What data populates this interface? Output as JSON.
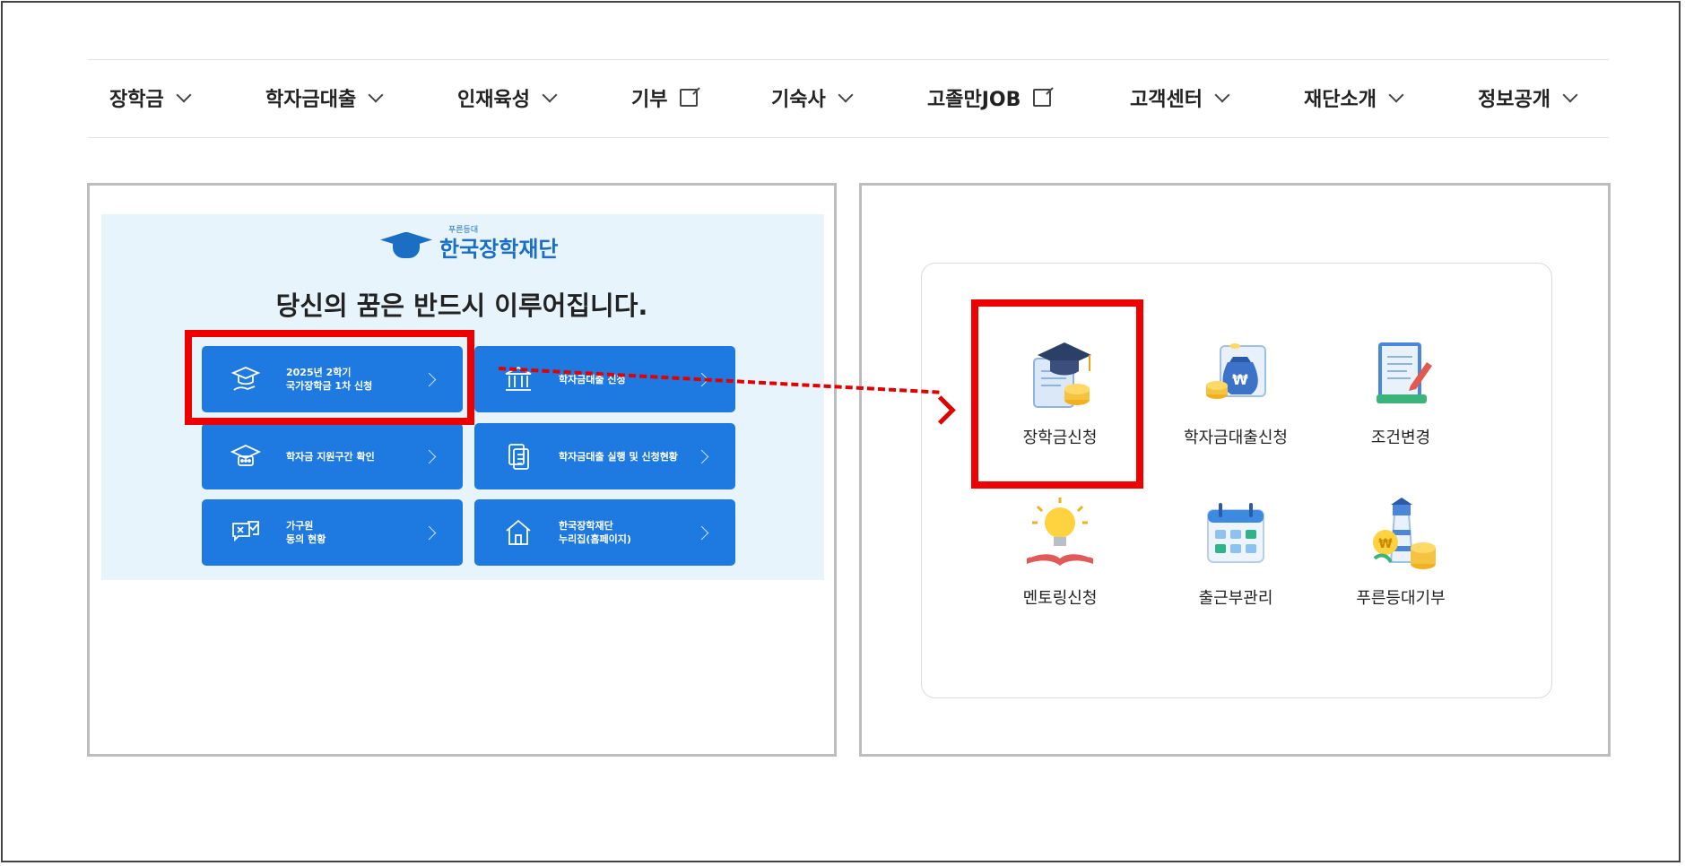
{
  "nav": {
    "items": [
      {
        "label": "장학금",
        "icon": "chevron-down-icon"
      },
      {
        "label": "학자금대출",
        "icon": "chevron-down-icon"
      },
      {
        "label": "인재육성",
        "icon": "chevron-down-icon"
      },
      {
        "label": "기부",
        "icon": "external-link-icon"
      },
      {
        "label": "기숙사",
        "icon": "chevron-down-icon"
      },
      {
        "label": "고졸만JOB",
        "icon": "external-link-icon"
      },
      {
        "label": "고객센터",
        "icon": "chevron-down-icon"
      },
      {
        "label": "재단소개",
        "icon": "chevron-down-icon"
      },
      {
        "label": "정보공개",
        "icon": "chevron-down-icon"
      }
    ]
  },
  "banner": {
    "logo_small": "푸른등대",
    "logo_text": "한국장학재단",
    "slogan": "당신의 꿈은 반드시 이루어집니다.",
    "buttons": [
      {
        "label": "2025년 2학기\n국가장학금 1차 신청",
        "icon": "graduation-hand-icon"
      },
      {
        "label": "학자금대출 신청",
        "icon": "bank-icon"
      },
      {
        "label": "학자금 지원구간 확인",
        "icon": "graduation-cap-icon"
      },
      {
        "label": "학자금대출 실행 및 신청현황",
        "icon": "documents-icon"
      },
      {
        "label": "가구원\n동의 현황",
        "icon": "check-message-icon"
      },
      {
        "label": "한국장학재단\n누리집(홈페이지)",
        "icon": "home-icon"
      }
    ]
  },
  "services": [
    {
      "label": "장학금신청",
      "icon": "graduation-cap-coins-icon"
    },
    {
      "label": "학자금대출신청",
      "icon": "money-bag-icon"
    },
    {
      "label": "조건변경",
      "icon": "document-pen-icon"
    },
    {
      "label": "멘토링신청",
      "icon": "lightbulb-book-icon"
    },
    {
      "label": "출근부관리",
      "icon": "calendar-icon"
    },
    {
      "label": "푸른등대기부",
      "icon": "lighthouse-coins-icon"
    }
  ],
  "colors": {
    "primary_button": "#1e7ae0",
    "banner_bg": "#e8f4fc",
    "brand": "#1a6fc4",
    "highlight": "#ee0000"
  }
}
